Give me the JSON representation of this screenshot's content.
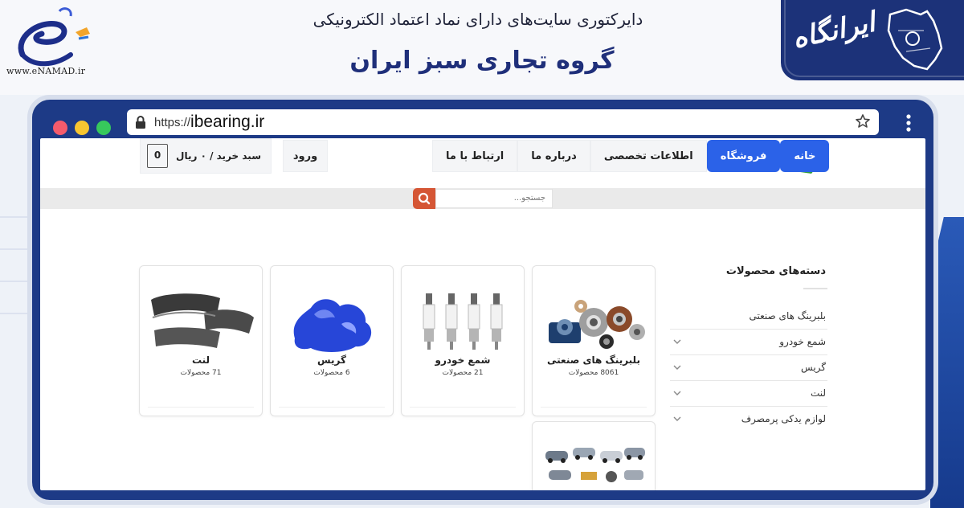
{
  "enamad": {
    "site_text": "www.eNAMAD.ir"
  },
  "header": {
    "directory_title": "دایرکتوری سایت‌های دارای نماد اعتماد الکترونیکی",
    "company_name": "گروه تجاری سبز ایران",
    "badge_text": "ایرانگاه"
  },
  "browser": {
    "url_prefix": "https://",
    "url_domain": "ibearing.ir"
  },
  "site": {
    "nav": [
      {
        "label": "خانه",
        "active": false
      },
      {
        "label": "فروشگاه",
        "active": true
      },
      {
        "label": "اطلاعات تخصصی",
        "active": false
      },
      {
        "label": "درباره ما",
        "active": false
      },
      {
        "label": "ارتباط با ما",
        "active": false
      }
    ],
    "login_label": "ورود",
    "cart_label": "سبد خرید / ۰ ریال",
    "cart_count": "0",
    "search_placeholder": "جستجو..."
  },
  "sidebar": {
    "title": "دسته‌های محصولات",
    "categories": [
      {
        "label": "بلبرینگ های صنعتی"
      },
      {
        "label": "شمع خودرو"
      },
      {
        "label": "گریس"
      },
      {
        "label": "لنت"
      },
      {
        "label": "لوازم یدکی پرمصرف"
      }
    ]
  },
  "products": [
    {
      "title": "بلبرینگ های صنعتی",
      "count": "8061 محصولات"
    },
    {
      "title": "شمع خودرو",
      "count": "21 محصولات"
    },
    {
      "title": "گریس",
      "count": "6 محصولات"
    },
    {
      "title": "لنت",
      "count": "71 محصولات"
    }
  ],
  "colors": {
    "accent_blue": "#2b62e8",
    "brand_navy": "#1f2f7a",
    "search_orange": "#d55635"
  }
}
